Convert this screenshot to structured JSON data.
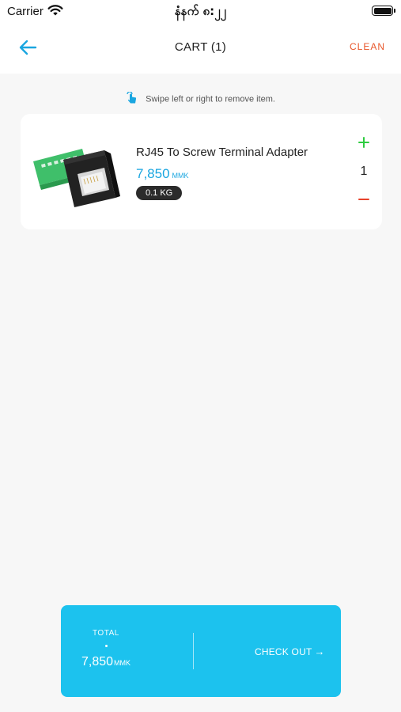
{
  "status_bar": {
    "carrier": "Carrier",
    "time": "နံနက် ၈:၂၂"
  },
  "header": {
    "title": "CART (1)",
    "clean_label": "CLEAN"
  },
  "hint": {
    "text": "Swipe left or right to remove item."
  },
  "cart_items": [
    {
      "name": "RJ45 To Screw Terminal Adapter",
      "price": "7,850",
      "currency": "MMK",
      "weight": "0.1 KG",
      "quantity": "1"
    }
  ],
  "checkout": {
    "total_label": "TOTAL",
    "total_value": "7,850",
    "total_unit": "MMK",
    "button_label": "CHECK OUT"
  },
  "colors": {
    "accent": "#1aa6e0",
    "checkout_bg": "#1cc2ee",
    "clean": "#e8572b",
    "plus": "#2ecc40",
    "minus": "#e8422b"
  }
}
